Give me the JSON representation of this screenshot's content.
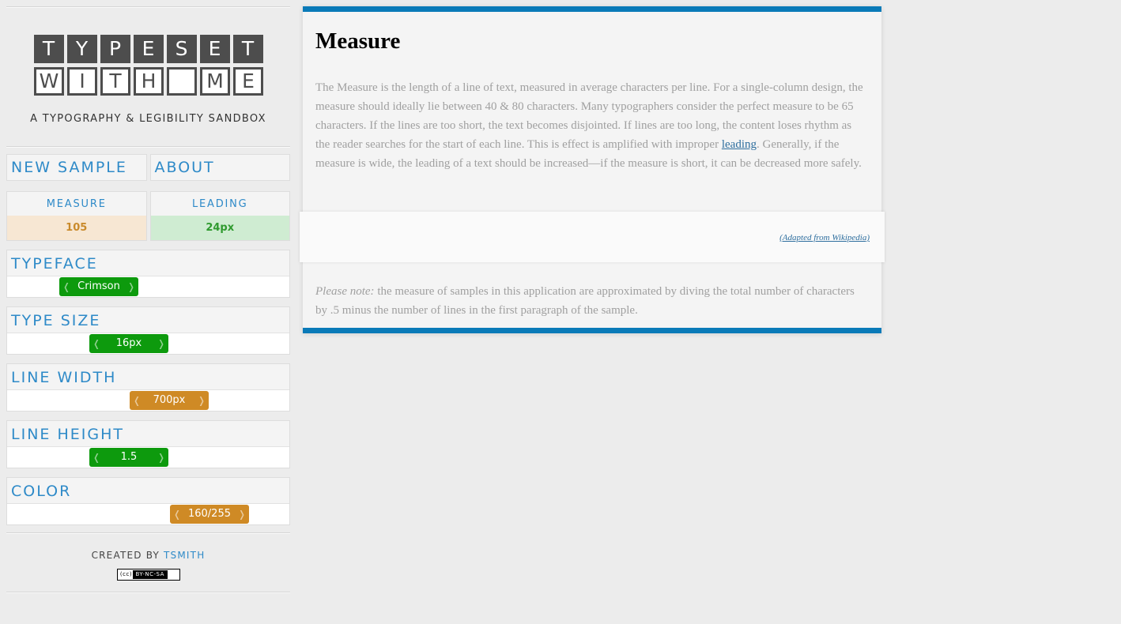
{
  "logo": {
    "row1": [
      "T",
      "Y",
      "P",
      "E",
      "S",
      "E",
      "T"
    ],
    "row2": [
      "W",
      "I",
      "T",
      "H",
      "",
      "M",
      "E"
    ]
  },
  "tagline": "A TYPOGRAPHY & LEGIBILITY SANDBOX",
  "nav": {
    "new_sample": "NEW SAMPLE",
    "about": "ABOUT"
  },
  "stats": {
    "measure_label": "MEASURE",
    "measure_value": "105",
    "leading_label": "LEADING",
    "leading_value": "24px"
  },
  "controls": {
    "typeface": {
      "title": "TYPEFACE",
      "value": "Crimson"
    },
    "type_size": {
      "title": "TYPE SIZE",
      "value": "16px"
    },
    "line_width": {
      "title": "LINE WIDTH",
      "value": "700px"
    },
    "line_height": {
      "title": "LINE HEIGHT",
      "value": "1.5"
    },
    "color": {
      "title": "COLOR",
      "value": "160/255"
    }
  },
  "slider_arrows": {
    "left": "❬",
    "right": "❭"
  },
  "credits": {
    "prefix": "CREATED BY ",
    "author": "TSMITH",
    "cc_mark": "(cc)",
    "license": "BY-NC-SA"
  },
  "article": {
    "title": "Measure",
    "body_before_link": "The Measure is the length of a line of text, measured in average characters per line. For a single-column design, the measure should ideally lie between 40 & 80 characters. Many typographers consider the perfect measure to be 65 characters. If the lines are too short, the text becomes disjointed. If lines are too long, the content loses rhythm as the reader searches for the start of each line. This is effect is amplified with improper ",
    "link_text": "leading",
    "body_after_link": ". Generally, if the measure is wide, the leading of a text should be increased—if the measure is short, it can be decreased more safely.",
    "attribution": "(Adapted from Wikipedia)",
    "note_label": "Please note:",
    "note_text": " the measure of samples in this application are approximated by diving the total number of characters by .5 minus the number of lines in the first paragraph of the sample."
  },
  "colors": {
    "accent_blue": "#0a7ab8",
    "link_blue": "#2e8ac8",
    "slider_green": "#0d9a0d",
    "slider_orange": "#cf8a25"
  }
}
